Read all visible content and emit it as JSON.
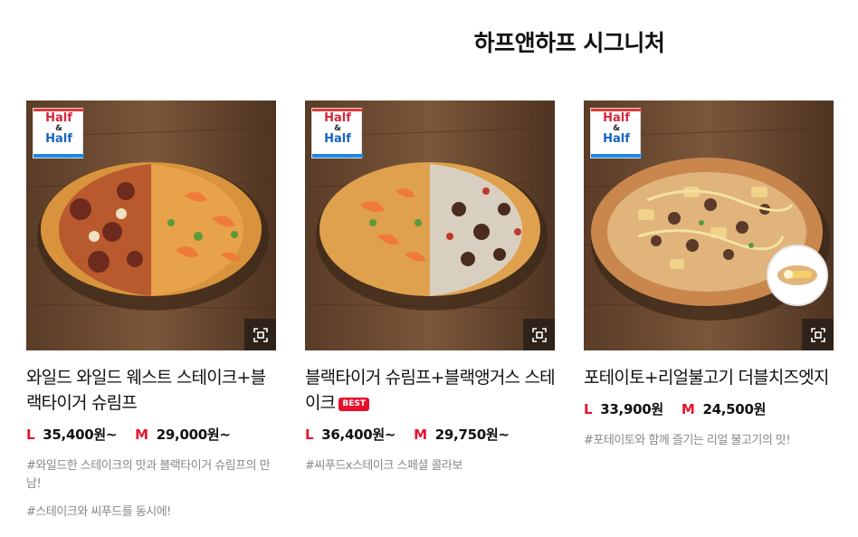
{
  "section": {
    "title": "하프앤하프 시그니처"
  },
  "products": [
    {
      "name": "와일드 와일드 웨스트 스테이크+블랙타이거 슈림프",
      "best": "",
      "large_size": "L",
      "large_price": "35,400원~",
      "medium_size": "M",
      "medium_price": "29,000원~",
      "desc": [
        "#와일드한 스테이크의 맛과 블랙타이거 슈림프의 만남!",
        "#스테이크와 씨푸드를 동시에!"
      ],
      "badge_top": "Half",
      "badge_amp": "&",
      "badge_bottom": "Half"
    },
    {
      "name": "블랙타이거 슈림프+블랙앵거스 스테이크",
      "best": "BEST",
      "large_size": "L",
      "large_price": "36,400원~",
      "medium_size": "M",
      "medium_price": "29,750원~",
      "desc": [
        "#씨푸드x스테이크 스페셜 콜라보"
      ],
      "badge_top": "Half",
      "badge_amp": "&",
      "badge_bottom": "Half"
    },
    {
      "name": "포테이토+리얼불고기 더블치즈엣지",
      "best": "",
      "large_size": "L",
      "large_price": "33,900원",
      "medium_size": "M",
      "medium_price": "24,500원",
      "desc": [
        "#포테이토와 함께 즐기는 리얼 불고기의 맛!"
      ],
      "badge_top": "Half",
      "badge_amp": "&",
      "badge_bottom": "Half"
    }
  ],
  "icons": {
    "zoom": "expand-icon",
    "badge": "half-and-half-logo"
  },
  "colors": {
    "accent": "#e8112d",
    "wood": "#6b4a30",
    "text": "#111111",
    "muted": "#888888"
  }
}
